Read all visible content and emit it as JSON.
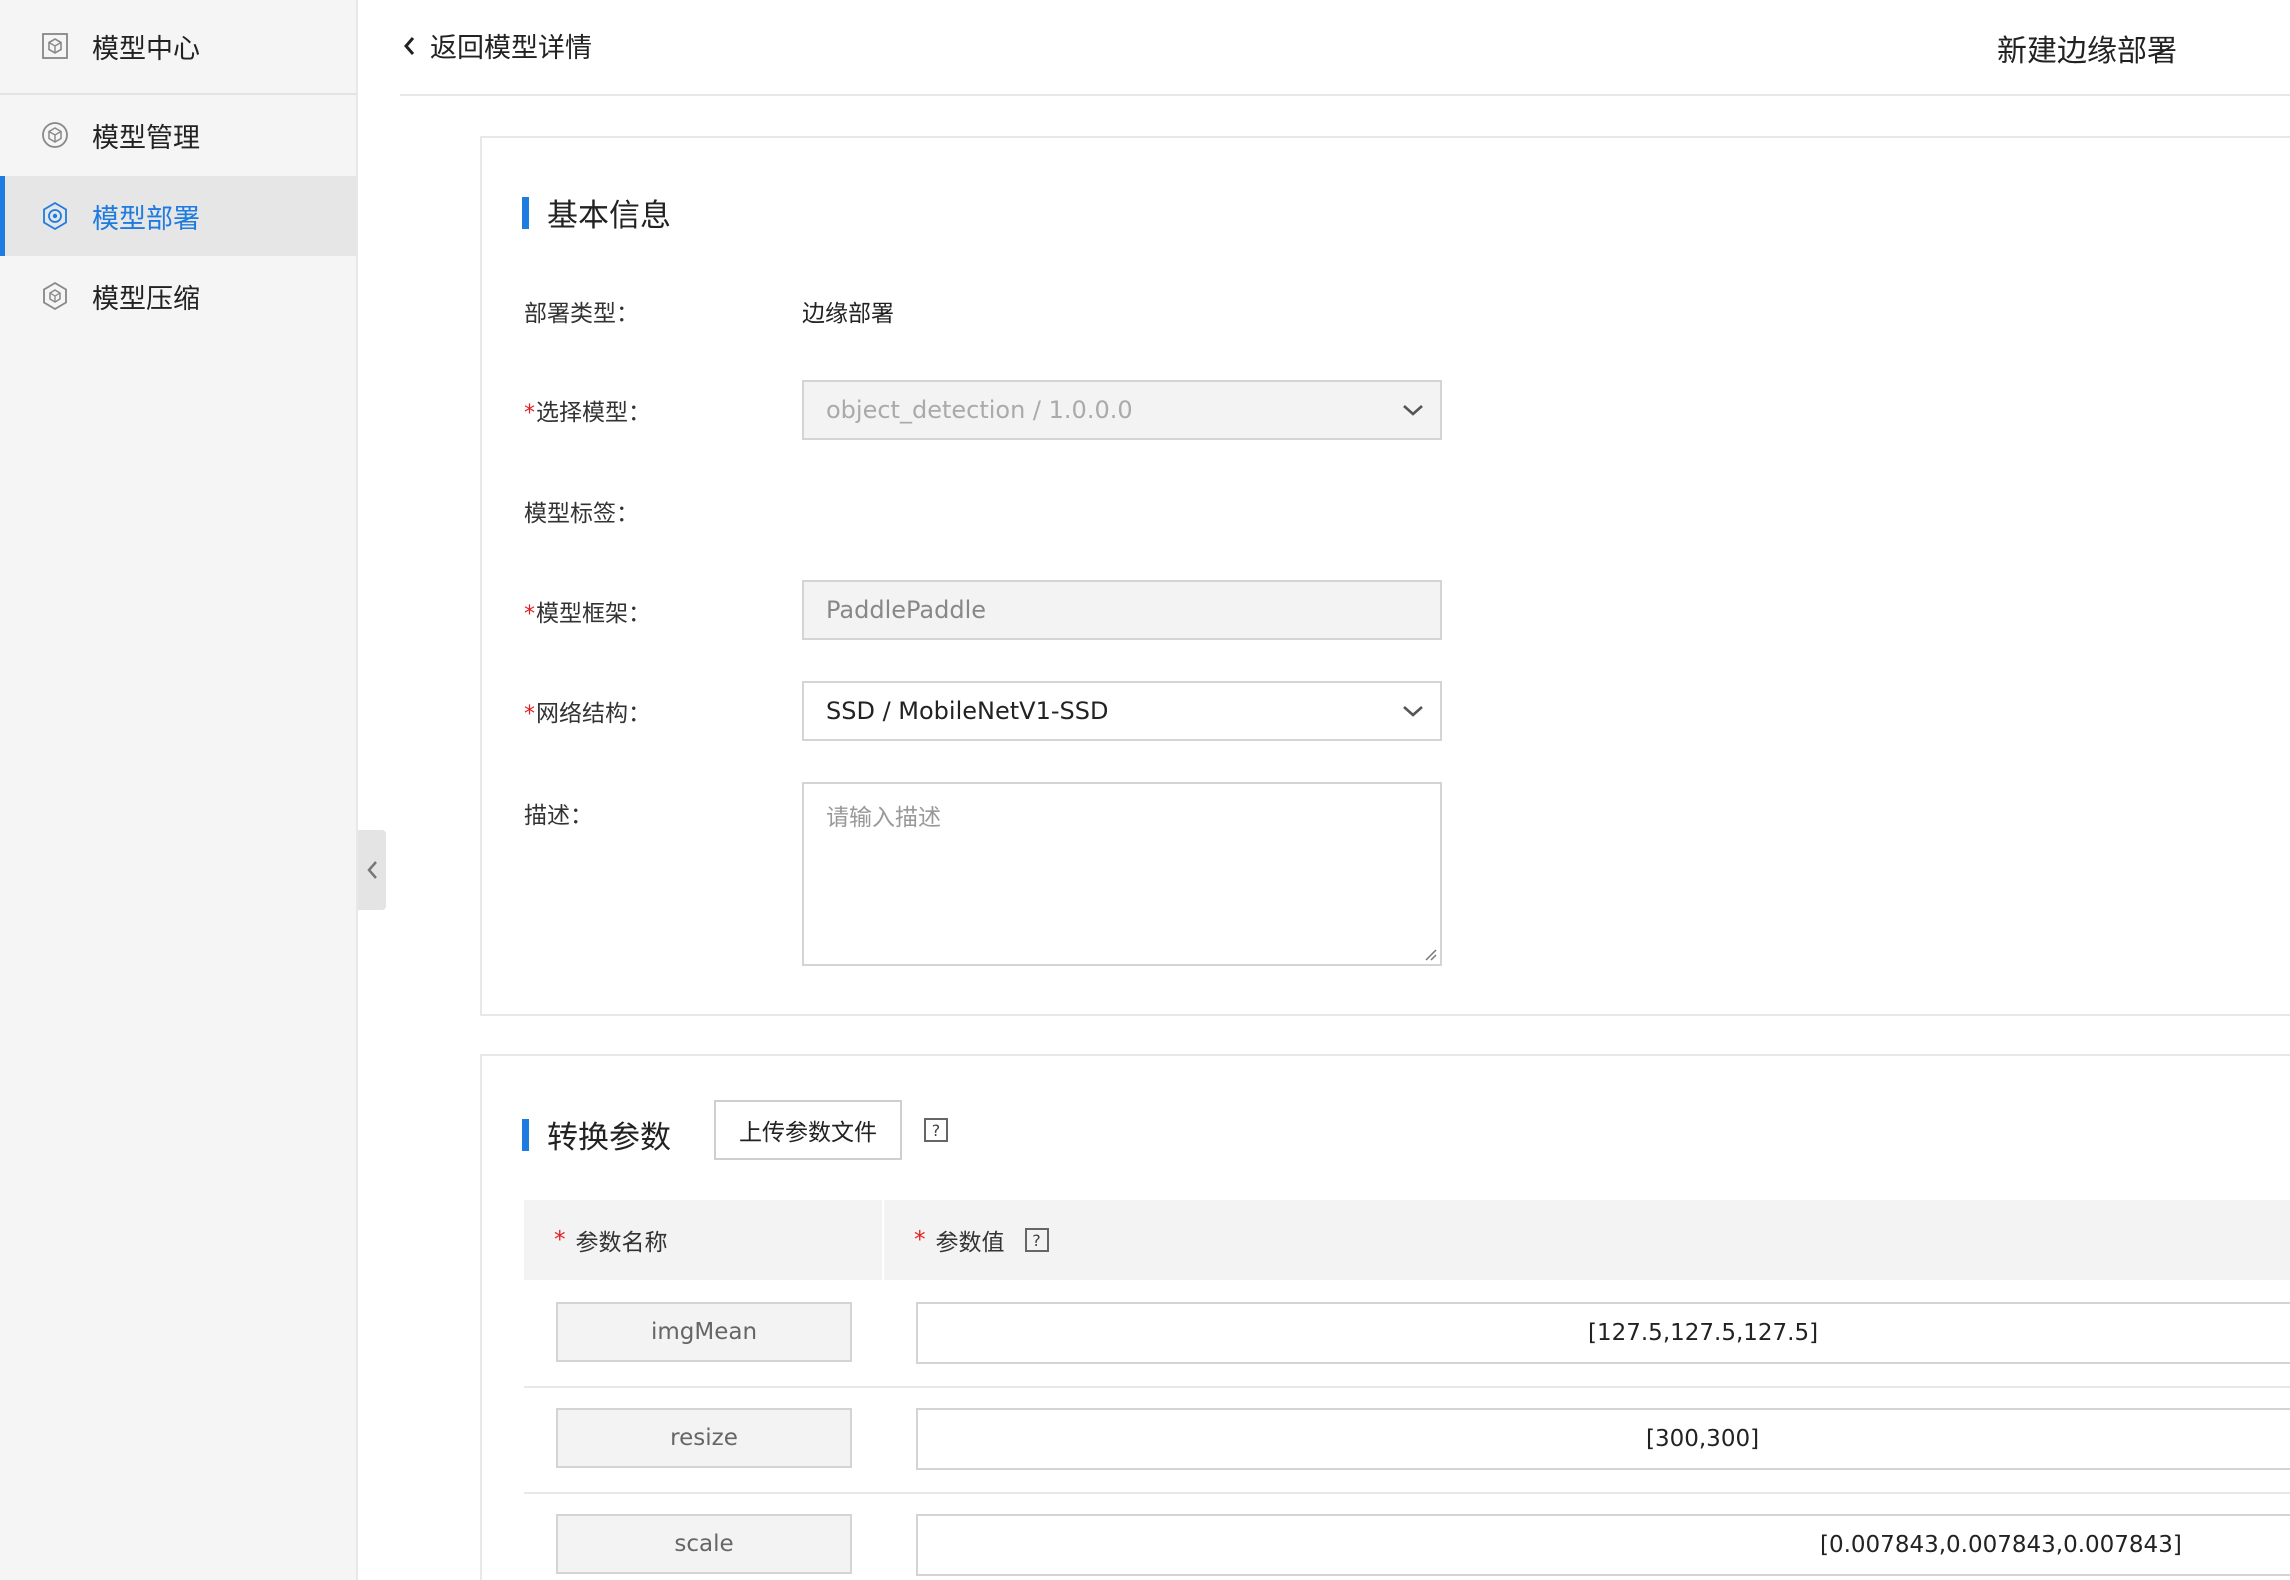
{
  "sidebar": {
    "header": "模型中心",
    "items": [
      {
        "label": "模型管理"
      },
      {
        "label": "模型部署"
      },
      {
        "label": "模型压缩"
      }
    ]
  },
  "header": {
    "back_label": "返回模型详情",
    "title": "新建边缘部署"
  },
  "basic": {
    "section_title": "基本信息",
    "deploy_type_label": "部署类型：",
    "deploy_type_value": "边缘部署",
    "model_label": "选择模型：",
    "model_value": "object_detection / 1.0.0.0",
    "tag_label": "模型标签：",
    "framework_label": "模型框架：",
    "framework_value": "PaddlePaddle",
    "network_label": "网络结构：",
    "network_value": "SSD / MobileNetV1-SSD",
    "desc_label": "描述：",
    "desc_placeholder": "请输入描述",
    "required_mark": "*"
  },
  "convert": {
    "section_title": "转换参数",
    "upload_label": "上传参数文件",
    "help_glyph": "?",
    "col_name": "参数名称",
    "col_value": "参数值",
    "rows": [
      {
        "name": "imgMean",
        "value": "[127.5,127.5,127.5]"
      },
      {
        "name": "resize",
        "value": "[300,300]"
      },
      {
        "name": "scale",
        "value": "[0.007843,0.007843,0.007843]"
      }
    ]
  },
  "colors": {
    "accent": "#1e7be0",
    "required": "#e02020"
  }
}
